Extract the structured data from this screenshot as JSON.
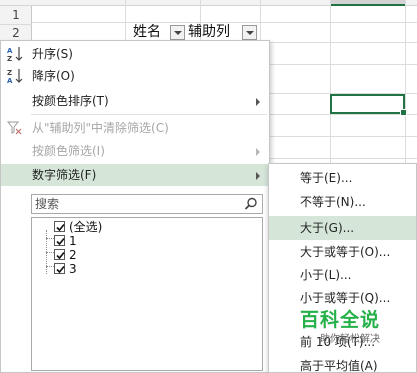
{
  "sheet": {
    "row_numbers": [
      "1",
      "2"
    ],
    "headers": {
      "name": "姓名",
      "helper": "辅助列"
    }
  },
  "filter_menu": {
    "sort_asc": "升序(S)",
    "sort_desc": "降序(O)",
    "sort_by_color": "按颜色排序(T)",
    "clear_filter": "从\"辅助列\"中清除筛选(C)",
    "filter_by_color": "按颜色筛选(I)",
    "number_filters": "数字筛选(F)",
    "search_placeholder": "搜索",
    "values": [
      "(全选)",
      "1",
      "2",
      "3"
    ],
    "checked": [
      true,
      true,
      true,
      true
    ]
  },
  "number_filter_submenu": {
    "items": [
      "等于(E)...",
      "不等于(N)...",
      "大于(G)...",
      "大于或等于(O)...",
      "小于(L)...",
      "小于或等于(Q)...",
      "前 10 项(T)...",
      "高于平均值(A)"
    ],
    "highlighted_index": 2
  },
  "watermark": {
    "title": "百科全说",
    "subtitle": "助你轻松解决"
  },
  "colors": {
    "accent_green": "#217346",
    "hover_bg": "#d5e6d9",
    "watermark_green": "#25b04a"
  }
}
